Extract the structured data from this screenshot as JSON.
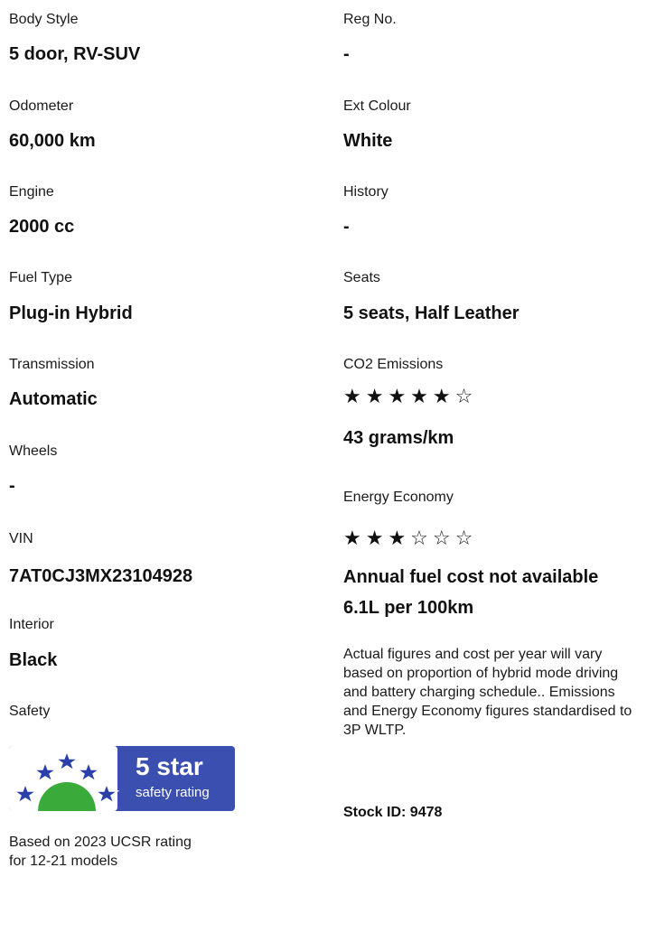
{
  "left": {
    "body_style": {
      "label": "Body Style",
      "value": "5 door, RV-SUV"
    },
    "odometer": {
      "label": "Odometer",
      "value": "60,000 km"
    },
    "engine": {
      "label": "Engine",
      "value": "2000 cc"
    },
    "fuel_type": {
      "label": "Fuel Type",
      "value": "Plug-in Hybrid"
    },
    "transmission": {
      "label": "Transmission",
      "value": "Automatic"
    },
    "wheels": {
      "label": "Wheels",
      "value": "-"
    },
    "vin": {
      "label": "VIN",
      "value": "7AT0CJ3MX23104928"
    },
    "interior": {
      "label": "Interior",
      "value": "Black"
    },
    "safety": {
      "label": "Safety",
      "badge_line1": "5 star",
      "badge_line2": "safety rating",
      "badge_stars": 5,
      "badge_colors": {
        "bg": "#3a4fb0",
        "arc": "#3aaa3a",
        "star": "#2a3fa8",
        "text": "#ffffff"
      },
      "note_line1": "Based on 2023 UCSR rating",
      "note_line2": "for 12-21 models"
    }
  },
  "right": {
    "reg_no": {
      "label": "Reg No.",
      "value": "-"
    },
    "ext_colour": {
      "label": "Ext Colour",
      "value": "White"
    },
    "history": {
      "label": "History",
      "value": "-"
    },
    "seats": {
      "label": "Seats",
      "value": "5 seats, Half Leather"
    },
    "co2": {
      "label": "CO2 Emissions",
      "stars": "★★★★★☆",
      "rating": 5,
      "max": 6,
      "value": "43 grams/km"
    },
    "energy": {
      "label": "Energy Economy",
      "stars": "★★★☆☆☆",
      "rating": 3,
      "max": 6
    },
    "fuel_cost": "Annual fuel cost not available",
    "fuel_rate": "6.1L per 100km",
    "disclaimer": "Actual figures and cost per year will vary based on proportion of hybrid mode driving and battery charging schedule.. Emissions and Energy Economy figures standardised to 3P WLTP.",
    "stock_id": "Stock ID: 9478"
  }
}
